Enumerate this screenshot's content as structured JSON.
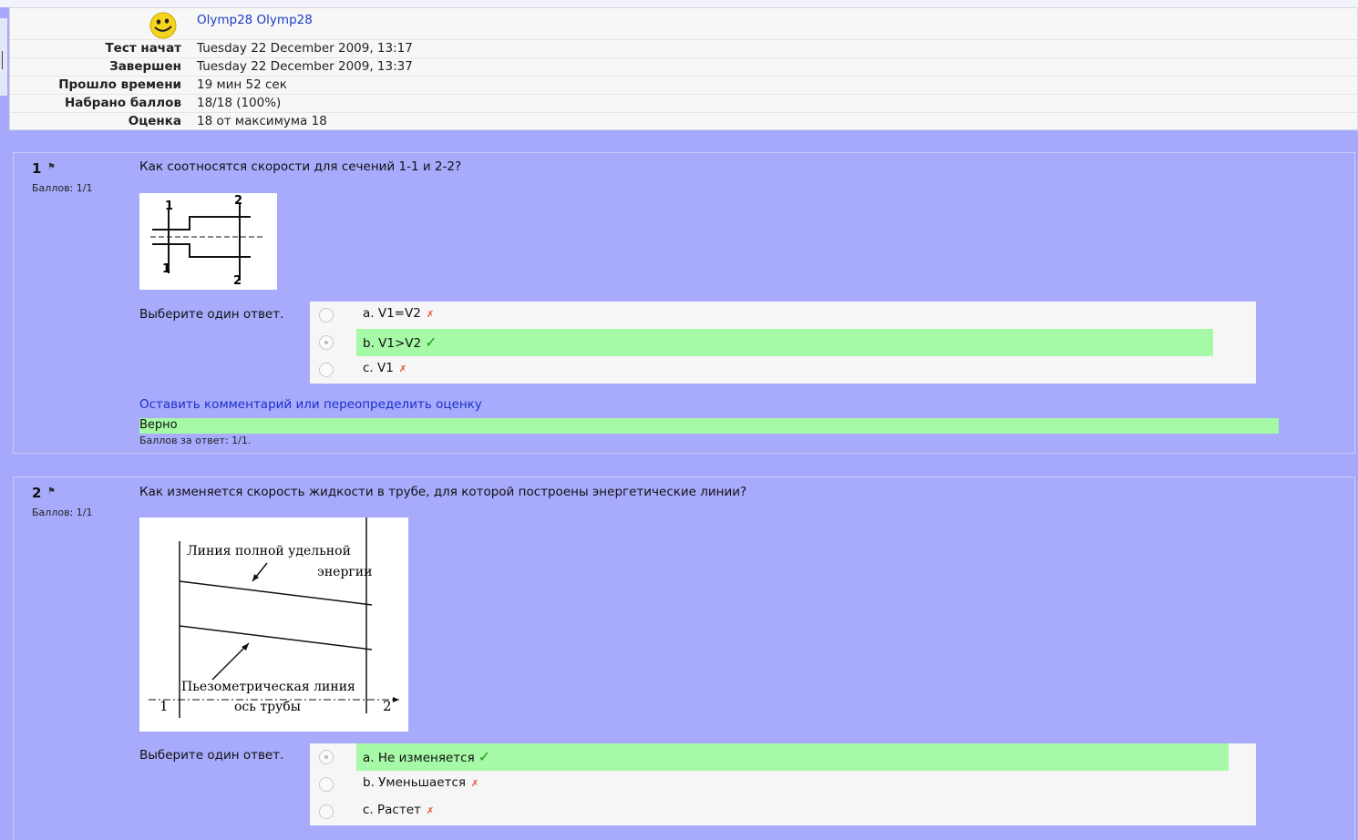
{
  "attempt": {
    "user_name": "Olymp28 Olymp28",
    "rows": [
      {
        "label": "Тест начат",
        "value": "Tuesday 22 December 2009, 13:17"
      },
      {
        "label": "Завершен",
        "value": "Tuesday 22 December 2009, 13:37"
      },
      {
        "label": "Прошло времени",
        "value": "19 мин 52 сек"
      },
      {
        "label": "Набрано баллов",
        "value": "18/18 (100%)"
      },
      {
        "label": "Оценка",
        "value": "18 от максимума 18"
      }
    ]
  },
  "questions": [
    {
      "number": "1",
      "grade": "Баллов: 1/1",
      "text": "Как соотносятся скорости для сечений 1-1 и 2-2?",
      "figure_labels": {
        "top_left": "1",
        "top_right": "2",
        "bottom_left": "1",
        "bottom_right": "2"
      },
      "prompt": "Выберите один ответ.",
      "answers": [
        {
          "label": "a. V1=V2",
          "correct": false,
          "selected": false
        },
        {
          "label": "b. V1>V2",
          "correct": true,
          "selected": true
        },
        {
          "label": "c. V1",
          "correct": false,
          "selected": false
        }
      ],
      "comment_link": "Оставить комментарий или переопределить оценку",
      "feedback": "Верно",
      "score_line": "Баллов за ответ: 1/1."
    },
    {
      "number": "2",
      "grade": "Баллов: 1/1",
      "text": "Как изменяется скорость жидкости в трубе, для которой построены энергетические линии?",
      "figure_labels": {
        "energy_line_1": "Линия полной удельной",
        "energy_line_2": "энергии",
        "piezo_line": "Пьезометрическая линия",
        "axis": "ось трубы",
        "section_left": "1",
        "section_right": "2"
      },
      "prompt": "Выберите один ответ.",
      "answers": [
        {
          "label": "a. Не изменяется",
          "correct": true,
          "selected": true
        },
        {
          "label": "b. Уменьшается",
          "correct": false,
          "selected": false
        },
        {
          "label": "c. Растет",
          "correct": false,
          "selected": false
        }
      ]
    }
  ],
  "icons": {
    "avatar": "smiley-avatar-icon",
    "flag": "flag-icon",
    "correct": "checkmark-icon",
    "incorrect": "cross-icon"
  },
  "colors": {
    "panel": "#a8abfc",
    "correct_bg": "#a6f9a6",
    "link": "#1a2fc8",
    "check": "#1e9a1e",
    "cross": "#e0502a"
  }
}
